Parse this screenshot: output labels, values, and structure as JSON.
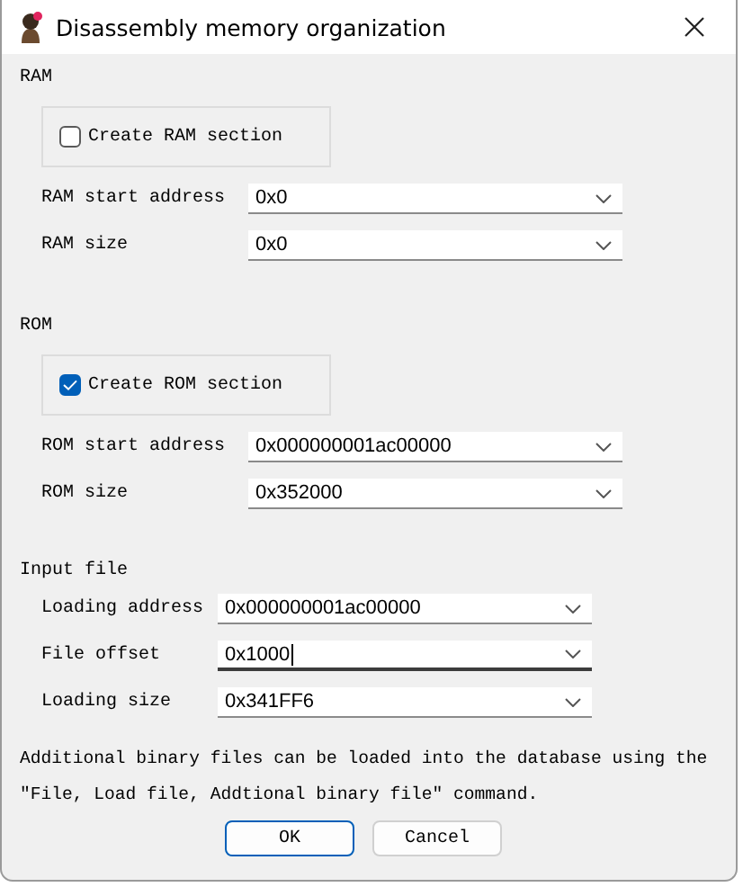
{
  "window": {
    "title": "Disassembly memory organization"
  },
  "sections": [
    {
      "label": "RAM",
      "checkbox": {
        "label": "Create RAM section",
        "checked": false
      },
      "fields": [
        {
          "label": "RAM start address",
          "value": "0x0",
          "focused": false
        },
        {
          "label": "RAM size",
          "value": "0x0",
          "focused": false
        }
      ]
    },
    {
      "label": "ROM",
      "checkbox": {
        "label": "Create ROM section",
        "checked": true
      },
      "fields": [
        {
          "label": "ROM start address",
          "value": "0x000000001ac00000",
          "focused": false
        },
        {
          "label": "ROM size",
          "value": "0x352000",
          "focused": false
        }
      ]
    }
  ],
  "input_file": {
    "label": "Input file",
    "fields": [
      {
        "label": "Loading address",
        "value": "0x000000001ac00000",
        "focused": false
      },
      {
        "label": "File offset",
        "value": "0x1000",
        "focused": true
      },
      {
        "label": "Loading size",
        "value": "0x341FF6",
        "focused": false
      }
    ]
  },
  "note": "Additional binary files can be loaded into the database using the \"File, Load file, Addtional binary file\" command.",
  "buttons": [
    {
      "label": "OK",
      "default": true
    },
    {
      "label": "Cancel",
      "default": false
    }
  ]
}
